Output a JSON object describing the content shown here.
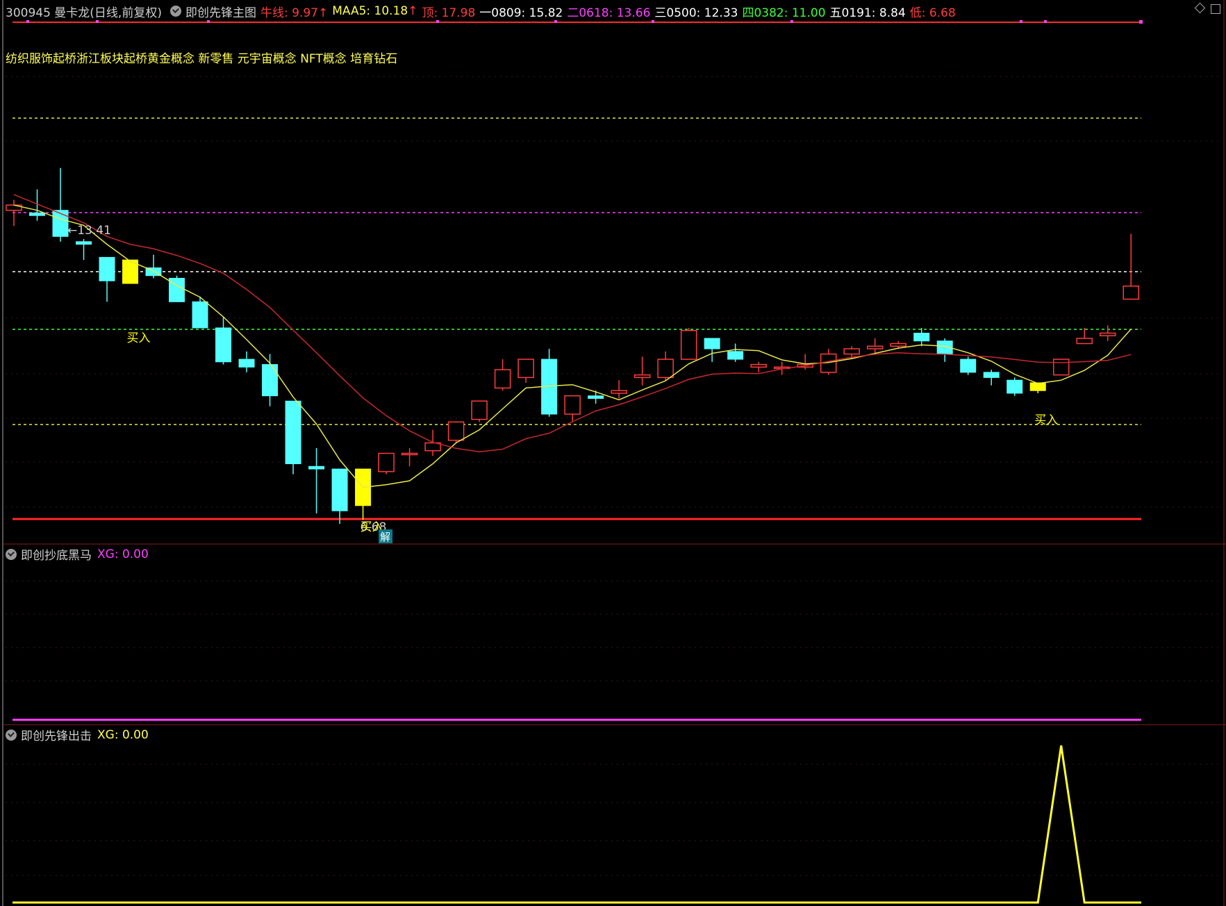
{
  "header": {
    "stock": "300945 曼卡龙(日线,前复权)",
    "indicator": "即创先锋主图",
    "niuxian": "牛线: 9.97",
    "maa5": "MAA5: 10.18",
    "ding": "顶: 17.98",
    "yi": "一0809: 15.82",
    "er": "二0618: 13.66",
    "san": "三0500: 12.33",
    "si": "四0382: 11.00",
    "wu": "五0191: 8.84",
    "di": "低: 6.68",
    "arrow": "↑"
  },
  "concepts": "纺织服饰起桥浙江板块起桥黄金概念 新零售 元宇宙概念 NFT概念 培育钻石",
  "annotations": {
    "high_label": "13.41",
    "buy1": "买入",
    "buy2": "买入",
    "low_label": "6.68",
    "jie": "解"
  },
  "panel2": {
    "name": "即创抄底黑马",
    "xg": "XG: 0.00"
  },
  "panel3": {
    "name": "即创先锋出击",
    "xg": "XG: 0.00"
  },
  "colors": {
    "up": "#ff3c3c",
    "down": "#54ffff",
    "buy": "#ffff00",
    "ma_short": "#e8e84a",
    "ma_long": "#c8282e",
    "panel_border": "#8b1a1a",
    "magenta": "#ff40ff"
  },
  "chart_data": {
    "type": "candlestick",
    "price_levels": {
      "ding": 17.98,
      "yi": 15.82,
      "er": 13.66,
      "san": 12.33,
      "si": 11.0,
      "wu": 8.84,
      "di": 6.68
    },
    "candles": [
      {
        "o": 12.6,
        "c": 12.7,
        "h": 12.8,
        "l": 12.3
      },
      {
        "o": 12.55,
        "c": 12.5,
        "h": 13.0,
        "l": 12.4
      },
      {
        "o": 12.6,
        "c": 12.1,
        "h": 13.41,
        "l": 12.0
      },
      {
        "o": 12.0,
        "c": 11.95,
        "h": 12.05,
        "l": 11.65
      },
      {
        "o": 11.7,
        "c": 11.25,
        "h": 11.7,
        "l": 10.85
      },
      {
        "o": 11.65,
        "c": 11.2,
        "h": 11.65,
        "l": 11.2,
        "buy": true
      },
      {
        "o": 11.5,
        "c": 11.35,
        "h": 11.75,
        "l": 11.3
      },
      {
        "o": 11.3,
        "c": 10.85,
        "h": 11.35,
        "l": 10.85
      },
      {
        "o": 10.85,
        "c": 10.35,
        "h": 10.95,
        "l": 10.35
      },
      {
        "o": 10.35,
        "c": 9.7,
        "h": 10.55,
        "l": 9.65
      },
      {
        "o": 9.75,
        "c": 9.6,
        "h": 9.9,
        "l": 9.5
      },
      {
        "o": 9.65,
        "c": 9.05,
        "h": 9.85,
        "l": 8.85
      },
      {
        "o": 8.95,
        "c": 7.75,
        "h": 8.95,
        "l": 7.55
      },
      {
        "o": 7.7,
        "c": 7.65,
        "h": 8.05,
        "l": 6.8
      },
      {
        "o": 7.65,
        "c": 6.85,
        "h": 7.65,
        "l": 6.6
      },
      {
        "o": 7.65,
        "c": 6.95,
        "h": 7.65,
        "l": 6.68,
        "buy": true
      },
      {
        "o": 7.6,
        "c": 7.95,
        "h": 7.95,
        "l": 7.55
      },
      {
        "o": 7.95,
        "c": 7.95,
        "h": 8.05,
        "l": 7.7
      },
      {
        "o": 8.0,
        "c": 8.15,
        "h": 8.4,
        "l": 7.9
      },
      {
        "o": 8.2,
        "c": 8.55,
        "h": 8.55,
        "l": 8.15
      },
      {
        "o": 8.6,
        "c": 8.95,
        "h": 8.95,
        "l": 8.55
      },
      {
        "o": 9.2,
        "c": 9.55,
        "h": 9.75,
        "l": 9.15
      },
      {
        "o": 9.4,
        "c": 9.75,
        "h": 9.75,
        "l": 9.3
      },
      {
        "o": 9.75,
        "c": 8.7,
        "h": 9.95,
        "l": 8.65
      },
      {
        "o": 8.7,
        "c": 9.05,
        "h": 9.05,
        "l": 8.55
      },
      {
        "o": 9.05,
        "c": 9.0,
        "h": 9.15,
        "l": 8.9
      },
      {
        "o": 9.1,
        "c": 9.15,
        "h": 9.35,
        "l": 9.0
      },
      {
        "o": 9.4,
        "c": 9.45,
        "h": 9.8,
        "l": 9.25
      },
      {
        "o": 9.4,
        "c": 9.75,
        "h": 9.9,
        "l": 9.35
      },
      {
        "o": 9.75,
        "c": 10.3,
        "h": 10.35,
        "l": 9.75
      },
      {
        "o": 10.15,
        "c": 9.95,
        "h": 10.15,
        "l": 9.7
      },
      {
        "o": 9.9,
        "c": 9.75,
        "h": 10.05,
        "l": 9.7
      },
      {
        "o": 9.6,
        "c": 9.65,
        "h": 9.7,
        "l": 9.5
      },
      {
        "o": 9.6,
        "c": 9.6,
        "h": 9.7,
        "l": 9.45
      },
      {
        "o": 9.6,
        "c": 9.65,
        "h": 9.85,
        "l": 9.55
      },
      {
        "o": 9.5,
        "c": 9.85,
        "h": 9.95,
        "l": 9.45
      },
      {
        "o": 9.85,
        "c": 9.95,
        "h": 10.0,
        "l": 9.75
      },
      {
        "o": 9.95,
        "c": 10.0,
        "h": 10.15,
        "l": 9.85
      },
      {
        "o": 10.0,
        "c": 10.05,
        "h": 10.1,
        "l": 9.95
      },
      {
        "o": 10.25,
        "c": 10.1,
        "h": 10.35,
        "l": 10.0
      },
      {
        "o": 10.1,
        "c": 9.85,
        "h": 10.15,
        "l": 9.7
      },
      {
        "o": 9.75,
        "c": 9.5,
        "h": 9.8,
        "l": 9.45
      },
      {
        "o": 9.5,
        "c": 9.4,
        "h": 9.55,
        "l": 9.25
      },
      {
        "o": 9.35,
        "c": 9.1,
        "h": 9.4,
        "l": 9.05
      },
      {
        "o": 9.3,
        "c": 9.15,
        "h": 9.3,
        "l": 9.1,
        "buy": true
      },
      {
        "o": 9.45,
        "c": 9.75,
        "h": 9.75,
        "l": 9.45
      },
      {
        "o": 10.05,
        "c": 10.15,
        "h": 10.35,
        "l": 10.05
      },
      {
        "o": 10.2,
        "c": 10.25,
        "h": 10.4,
        "l": 10.1
      },
      {
        "o": 10.9,
        "c": 11.15,
        "h": 12.15,
        "l": 10.9
      }
    ],
    "signal_panel3": [
      0,
      0,
      0,
      0,
      0,
      0,
      0,
      0,
      0,
      0,
      0,
      0,
      0,
      0,
      0,
      0,
      0,
      0,
      0,
      0,
      0,
      0,
      0,
      0,
      0,
      0,
      0,
      0,
      0,
      0,
      0,
      0,
      0,
      0,
      0,
      0,
      0,
      0,
      0,
      0,
      0,
      0,
      0,
      0,
      0,
      1,
      0,
      0,
      0
    ]
  }
}
